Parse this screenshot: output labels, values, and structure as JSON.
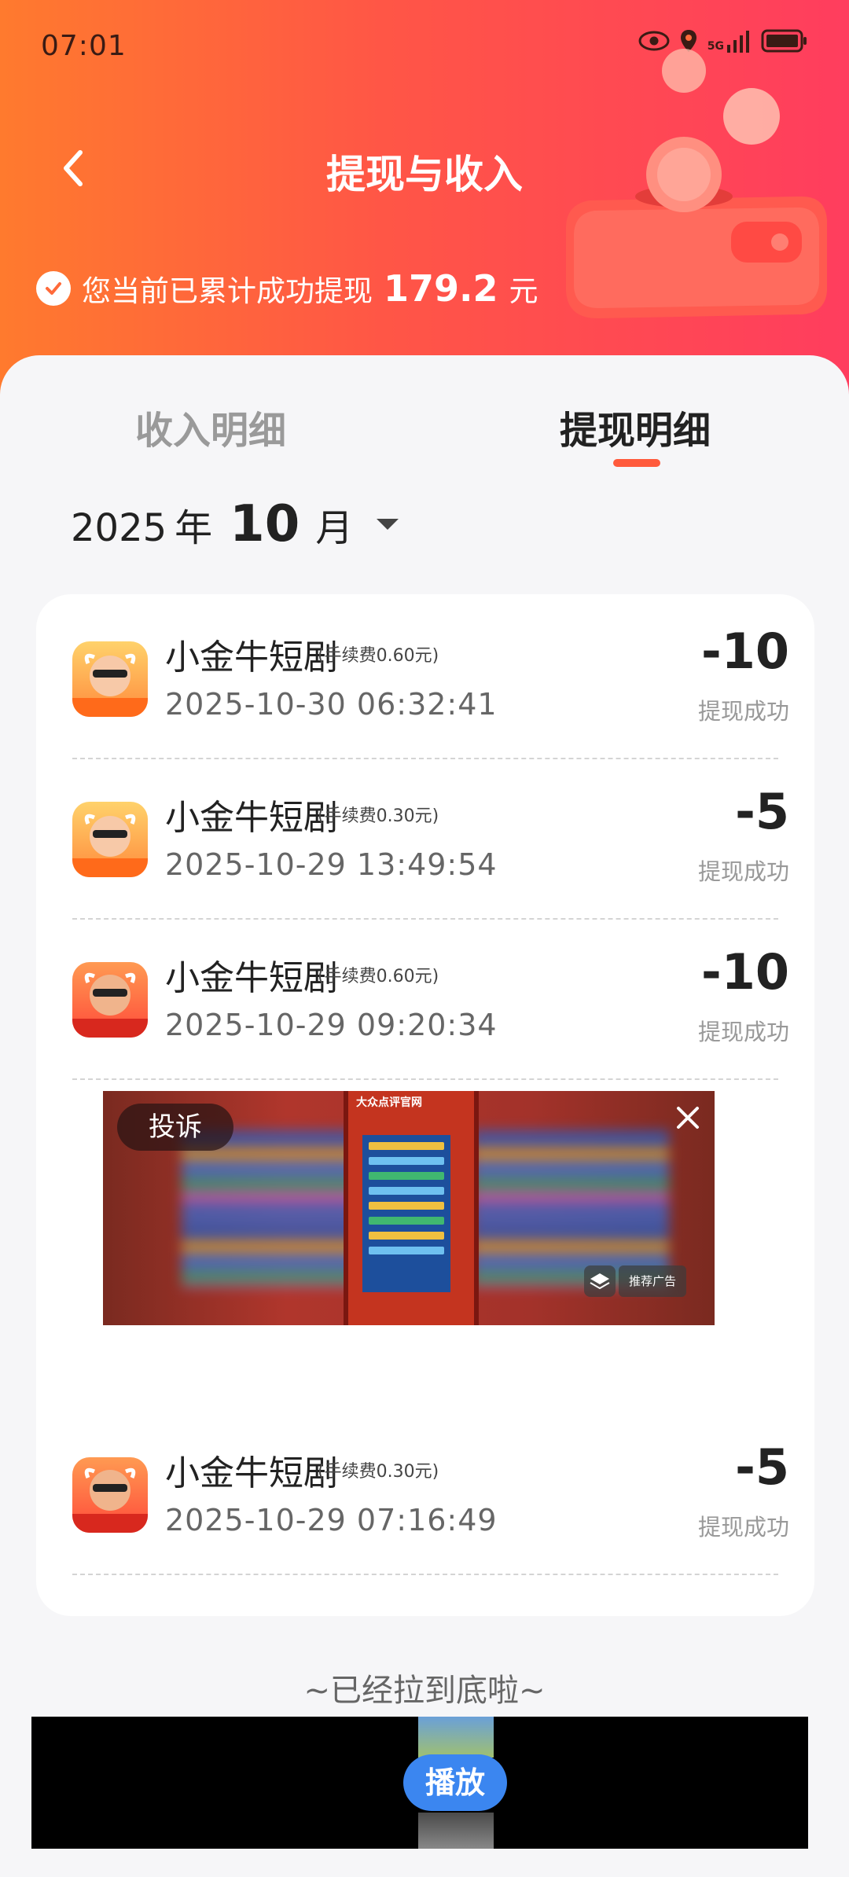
{
  "status_bar": {
    "time": "07:01",
    "network": "5G"
  },
  "header": {
    "title": "提现与收入",
    "summary_prefix": "您当前已累计成功提现",
    "summary_amount": "179.2",
    "summary_unit": "元"
  },
  "tabs": [
    {
      "label": "收入明细",
      "active": false
    },
    {
      "label": "提现明细",
      "active": true
    }
  ],
  "month_picker": {
    "year": "2025",
    "year_unit": "年",
    "month": "10",
    "month_unit": "月"
  },
  "records": [
    {
      "name": "小金牛短剧",
      "fee": "(手续费0.60元)",
      "date": "2025-10-30 06:32:41",
      "amount": "-10",
      "status": "提现成功",
      "icon": "cow-app-icon"
    },
    {
      "name": "小金牛短剧",
      "fee": "(手续费0.30元)",
      "date": "2025-10-29 13:49:54",
      "amount": "-5",
      "status": "提现成功",
      "icon": "cow-app-icon"
    },
    {
      "name": "小金牛短剧",
      "fee": "(手续费0.60元)",
      "date": "2025-10-29 09:20:34",
      "amount": "-10",
      "status": "提现成功",
      "icon": "cow-app-icon-red"
    },
    {
      "name": "小金牛短剧",
      "fee": "(手续费0.30元)",
      "date": "2025-10-29 07:16:49",
      "amount": "-5",
      "status": "提现成功",
      "icon": "cow-app-icon-red"
    }
  ],
  "ad": {
    "complain_label": "投诉",
    "phone_title": "大众点评官网",
    "tag": "推荐广告"
  },
  "footer": {
    "end_note": "~已经拉到底啦~",
    "play_label": "播放"
  },
  "colors": {
    "accent": "#ff5a3c",
    "header_start": "#ff7a2e",
    "header_end": "#ff3d5e",
    "play_button": "#3b86f0"
  }
}
